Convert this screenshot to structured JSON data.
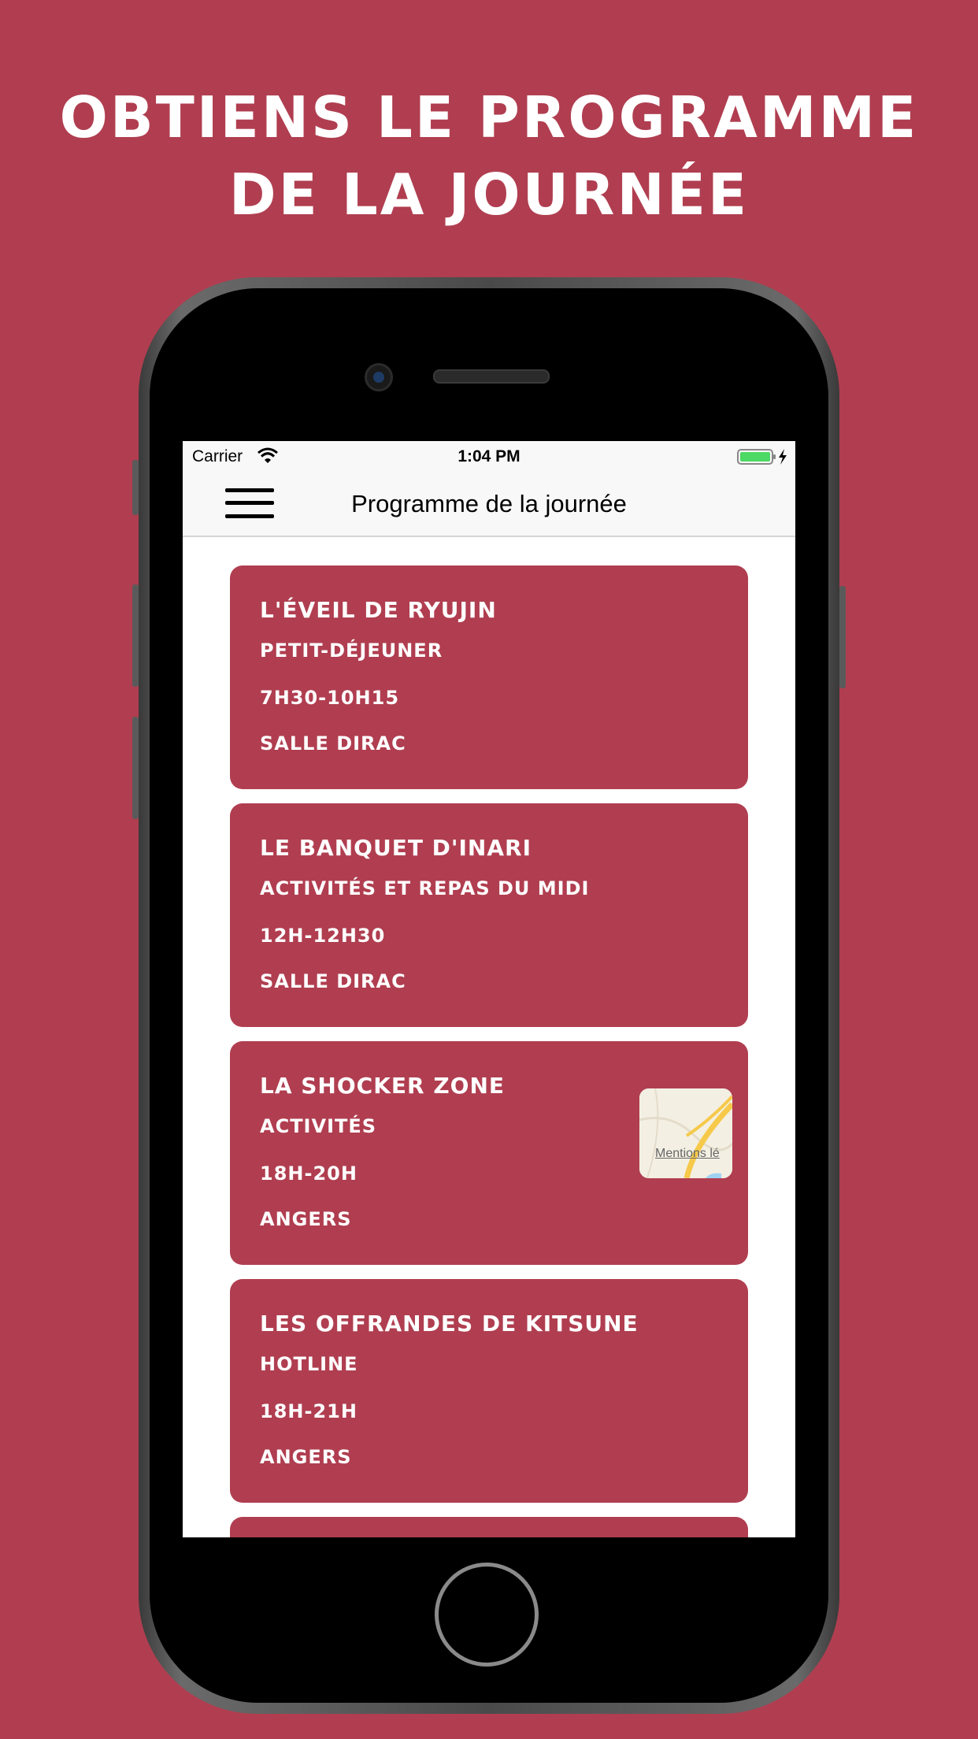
{
  "headline": {
    "line1": "Obtiens le programme",
    "line2": "de la journée"
  },
  "status_bar": {
    "carrier": "Carrier",
    "time": "1:04 PM",
    "wifi_icon": "wifi-icon",
    "battery_icon": "battery-charging-icon",
    "battery_color": "#4cd964"
  },
  "navbar": {
    "menu_icon": "hamburger-menu-icon",
    "title": "Programme de la journée"
  },
  "accent_color": "#b03e50",
  "events": [
    {
      "title": "L'éveil de Ryujin",
      "subtitle": "Petit-déjeuner",
      "hours": "7h30-10h15",
      "place": "Salle Dirac"
    },
    {
      "title": "Le banquet d'Inari",
      "subtitle": "Activités et repas du midi",
      "hours": "12h-12h30",
      "place": "Salle Dirac"
    },
    {
      "title": "La Shocker Zone",
      "subtitle": "Activités",
      "hours": "18h-20h",
      "place": "Angers",
      "map_legal": "Mentions lé"
    },
    {
      "title": "Les offrandes de Kitsune",
      "subtitle": "Hotline",
      "hours": "18h-21h",
      "place": "Angers"
    }
  ]
}
